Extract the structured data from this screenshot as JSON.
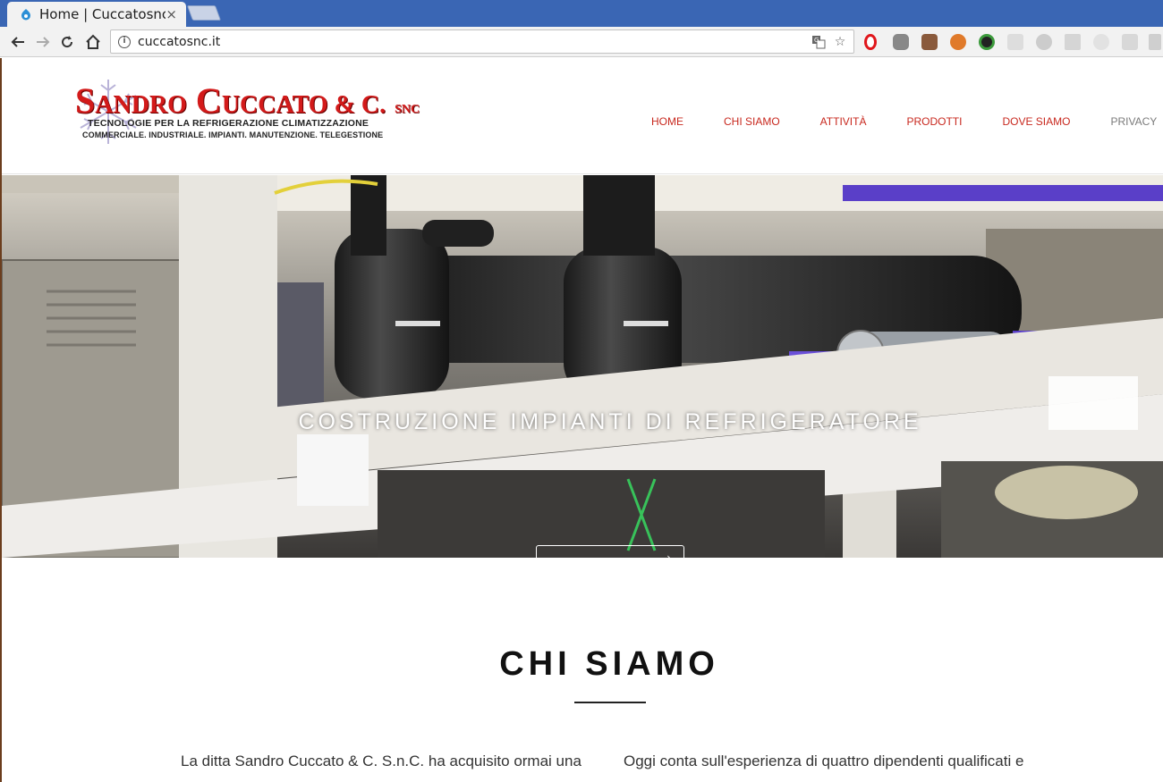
{
  "browser": {
    "tab_title": "Home | Cuccatosnc",
    "tab_close": "×",
    "url": "cuccatosnc.it",
    "info_icon": "i"
  },
  "logo": {
    "brand_first_big": "S",
    "brand_first_rest": "ANDRO",
    "brand_second_big": "C",
    "brand_second_rest": "UCCATO",
    "brand_amp": " & C.",
    "brand_snc": "SNC",
    "line1": "TECNOLOGIE PER LA REFRIGERAZIONE CLIMATIZZAZIONE",
    "line2": "COMMERCIALE. INDUSTRIALE. IMPIANTI. MANUTENZIONE. TELEGESTIONE",
    "color": "#d31a1a"
  },
  "nav": {
    "items": [
      {
        "label": "HOME"
      },
      {
        "label": "CHI SIAMO"
      },
      {
        "label": "ATTIVITÀ"
      },
      {
        "label": "PRODOTTI"
      },
      {
        "label": "DOVE SIAMO"
      },
      {
        "label": "PRIVACY"
      }
    ],
    "accent": "#c8281e"
  },
  "hero": {
    "caption": "COSTRUZIONE IMPIANTI DI REFRIGERATORE",
    "button_icon": "chevron-right-icon"
  },
  "about": {
    "title": "CHI SIAMO",
    "col_left": "La ditta Sandro Cuccato & C. S.n.C. ha acquisito ormai una",
    "col_right": "Oggi conta sull'esperienza di quattro dipendenti qualificati e"
  }
}
